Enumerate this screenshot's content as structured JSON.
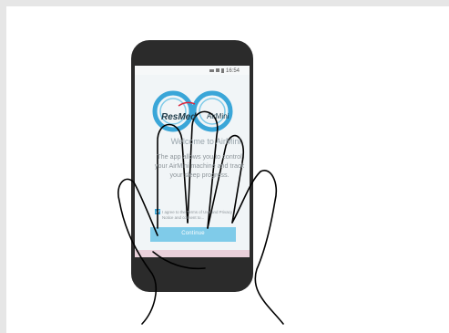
{
  "status_bar": {
    "time": "16:54"
  },
  "brand": {
    "resmed": "ResMed",
    "airmini": "AirMini"
  },
  "welcome": {
    "title": "Welcome to AirMini"
  },
  "intro": {
    "text": "The app allows you to control your AirMini machine and track your sleep progress."
  },
  "consent": {
    "checked": true,
    "text": "I agree to the Terms of Use and Privacy Notice and consent to..."
  },
  "continue_button": {
    "label": "Continue"
  },
  "colors": {
    "phone_body": "#2b2b2b",
    "accent_blue": "#3aa6d8",
    "button_blue": "#7fcbe9",
    "screen": "#f1f5f7"
  }
}
